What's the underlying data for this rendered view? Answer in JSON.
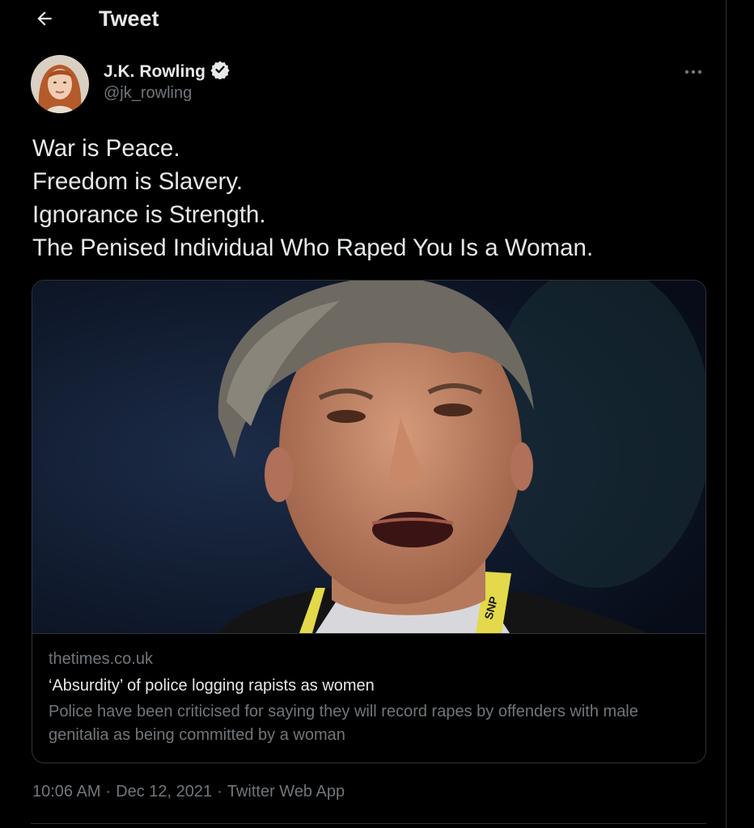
{
  "header": {
    "title": "Tweet",
    "back_icon": "arrow-left-icon"
  },
  "author": {
    "name": "J.K. Rowling",
    "handle": "@jk_rowling",
    "verified_icon": "verified-badge-icon",
    "more_icon": "more-dots-icon"
  },
  "tweet": {
    "lines": [
      "War is Peace.",
      "Freedom is Slavery.",
      "Ignorance is Strength.",
      "The Penised Individual Who Raped You Is a Woman."
    ]
  },
  "card": {
    "domain": "thetimes.co.uk",
    "title": "‘Absurdity’ of police logging rapists as women",
    "description": "Police have been criticised for saying they will record rapes by offenders with male genitalia as being committed by a woman",
    "lanyard_text": "SNP"
  },
  "meta": {
    "time": "10:06 AM",
    "date": "Dec 12, 2021",
    "source": "Twitter Web App",
    "separator": "·"
  },
  "colors": {
    "background": "#000000",
    "text_primary": "#e7e9ea",
    "text_secondary": "#71767b",
    "border": "#2f3336"
  }
}
